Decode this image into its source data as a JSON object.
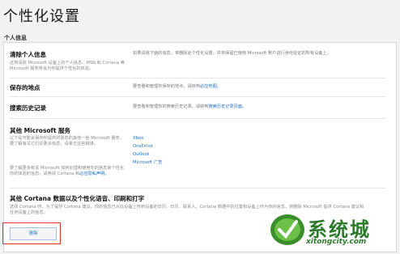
{
  "title": "个性化设置",
  "section_label": "个人信息",
  "rows": [
    {
      "title": "清除个人信息",
      "desc": "这将清除 Microsoft 设备上的个人信息、MSN 和 Cortana 等 Microsoft 服务将会为你提供个性化的体验。",
      "right": "如果清除下面的信息，将删除此个性化设置，并将保留已使用 Microsoft 账户进行身份验证的所有设备上。"
    },
    {
      "title": "保存的地点",
      "desc": "",
      "right_prefix": "要查看和管理你保存的地点，请转到",
      "right_link": "必应地图。"
    },
    {
      "title": "搜索历史记录",
      "desc": "",
      "right_prefix": "要查看和管理你的搜索历史记录，请转到",
      "right_link": "搜索历史记录页面。"
    },
    {
      "title": "其他 Microsoft 服务",
      "desc": "以下是可能会保存你提供的信息的其他一些 Microsoft 服务。要了解有关它们的更多信息，请单击这些链接。",
      "links": [
        "Xbox",
        "OneDrive",
        "Outlook",
        "Microsoft 广告"
      ]
    },
    {
      "title": "",
      "desc_prefix": "要了解更多有关 Microsoft 如何处理和使用你的信息来个性化你的体验的信息，请参阅 Cortana 和",
      "desc_link": "必应隐私声明。"
    },
    {
      "title": "其他 Cortana 数据以及个性化语音、印刷和打字",
      "desc": "选择 Cortana 时，为了提供 Cortana 建议，你的信息已从此设备上传到设备的日历、日历、联系人、Cortana 数据中的位置和设备上作为你的信息，将删除 Microsoft 提供 Cortana 建议和任何设备上的信息。"
    }
  ],
  "clear_button": "清除",
  "watermark": {
    "brand": "系统城",
    "url": "xitongcity.com"
  }
}
